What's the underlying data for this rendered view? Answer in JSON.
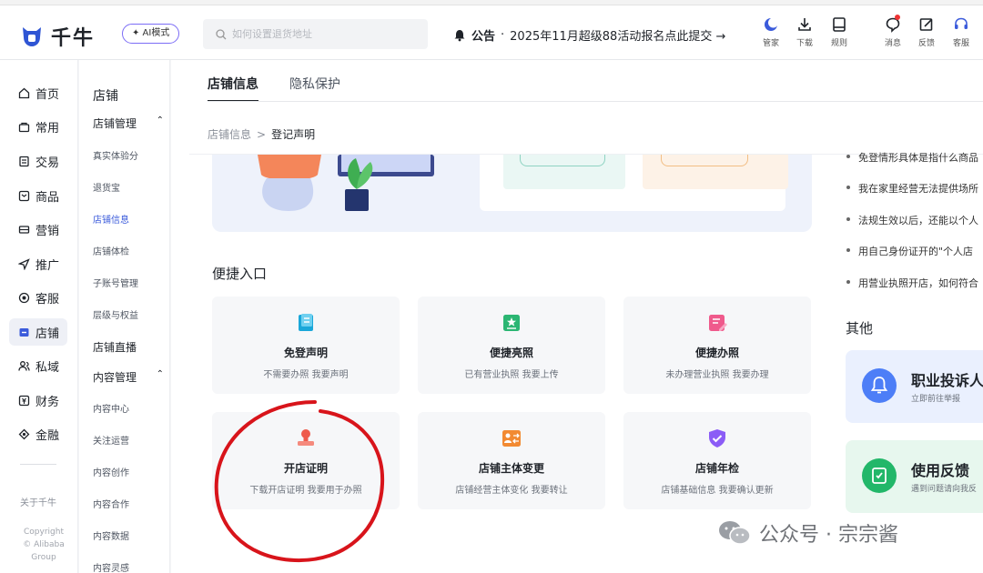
{
  "app": {
    "logo_text": "千牛",
    "ai_mode_label": "✦ AI模式"
  },
  "search": {
    "placeholder": "如何设置退货地址"
  },
  "notice": {
    "label": "公告",
    "text": "2025年11月超级88活动报名点此提交 →"
  },
  "tools": [
    {
      "label": "管家",
      "icon": "moon-assistant-icon"
    },
    {
      "label": "下载",
      "icon": "download-icon"
    },
    {
      "label": "规则",
      "icon": "book-icon"
    },
    {
      "label": "消息",
      "icon": "message-icon"
    },
    {
      "label": "反馈",
      "icon": "edit-icon"
    },
    {
      "label": "客服",
      "icon": "headset-icon"
    }
  ],
  "leftnav": {
    "items": [
      {
        "label": "首页",
        "icon": "home-icon"
      },
      {
        "label": "常用",
        "icon": "bag-icon"
      },
      {
        "label": "交易",
        "icon": "receipt-icon"
      },
      {
        "label": "商品",
        "icon": "product-icon"
      },
      {
        "label": "营销",
        "icon": "coupon-icon"
      },
      {
        "label": "推广",
        "icon": "send-icon"
      },
      {
        "label": "客服",
        "icon": "service-icon"
      },
      {
        "label": "店铺",
        "icon": "shop-icon",
        "active": true
      },
      {
        "label": "私域",
        "icon": "users-icon"
      },
      {
        "label": "财务",
        "icon": "finance-icon"
      },
      {
        "label": "金融",
        "icon": "fund-icon"
      }
    ],
    "about": "关于千牛",
    "copyright": [
      "Copyright",
      "© Alibaba",
      "Group"
    ]
  },
  "subnav": {
    "title": "店铺",
    "group1": "店铺管理",
    "group1_items": [
      "真实体验分",
      "退货宝",
      "店铺信息",
      "店铺体检",
      "子账号管理",
      "层级与权益"
    ],
    "live": "店铺直播",
    "group2": "内容管理",
    "group2_items": [
      "内容中心",
      "关注运营",
      "内容创作",
      "内容合作",
      "内容数据",
      "内容灵感"
    ],
    "active_item": "店铺信息"
  },
  "tabs": [
    "店铺信息",
    "隐私保护"
  ],
  "breadcrumb": {
    "parent": "店铺信息",
    "separator": ">",
    "current": "登记声明"
  },
  "quick_entry": {
    "title": "便捷入口",
    "cards": [
      {
        "title": "免登声明",
        "desc": "不需要办照 我要声明",
        "icon": "scroll-icon",
        "color": "#1aa7d9"
      },
      {
        "title": "便捷亮照",
        "desc": "已有营业执照 我要上传",
        "icon": "license-star-icon",
        "color": "#2bb673"
      },
      {
        "title": "便捷办照",
        "desc": "未办理营业执照 我要办理",
        "icon": "form-edit-icon",
        "color": "#ef5a8c"
      },
      {
        "title": "开店证明",
        "desc": "下载开店证明 我要用于办照",
        "icon": "stamp-icon",
        "color": "#ee5b4c"
      },
      {
        "title": "店铺主体变更",
        "desc": "店铺经营主体变化 我要转让",
        "icon": "transfer-icon",
        "color": "#f28a32"
      },
      {
        "title": "店铺年检",
        "desc": "店铺基础信息 我要确认更新",
        "icon": "shield-check-icon",
        "color": "#8b5cf6"
      }
    ]
  },
  "faq": [
    "免登情形具体是指什么商品",
    "我在家里经营无法提供场所",
    "法规生效以后，还能以个人",
    "用自己身份证开的\"个人店",
    "用营业执照开店，如何符合"
  ],
  "other": {
    "title": "其他",
    "cards": [
      {
        "title": "职业投诉人",
        "sub": "立即前往举报",
        "icon": "bell-icon",
        "color": "#4d7ef7",
        "bg": "#eaf0fe"
      },
      {
        "title": "使用反馈",
        "sub": "遇到问题请向我反",
        "icon": "feedback-icon",
        "color": "#22b769",
        "bg": "#e7f7ee"
      }
    ]
  },
  "watermark": {
    "text": "公众号 · 宗宗酱"
  }
}
